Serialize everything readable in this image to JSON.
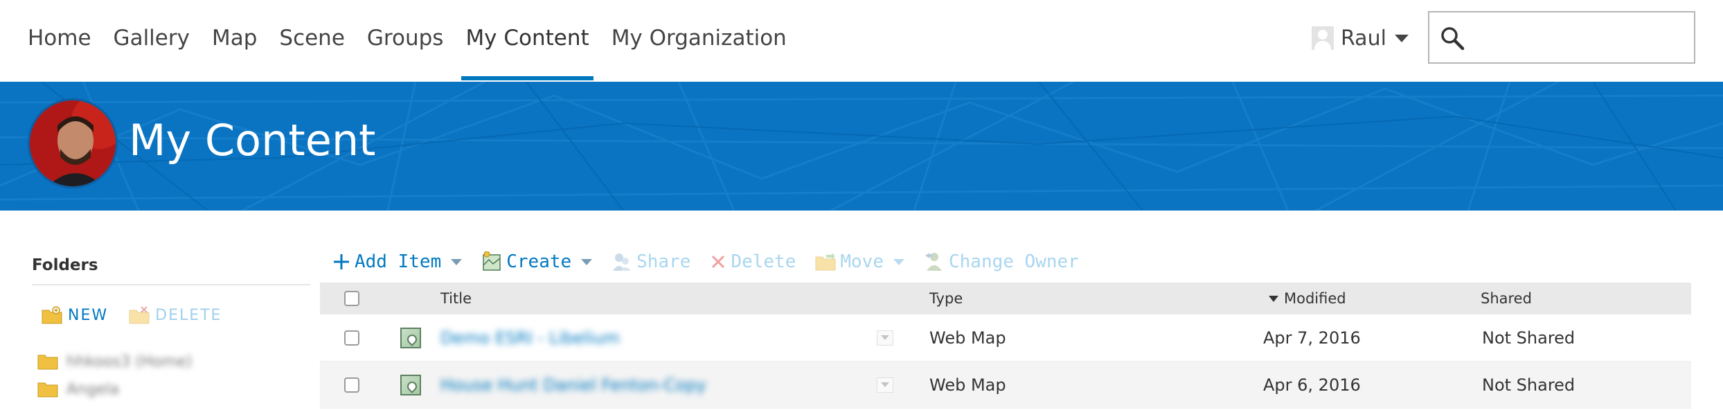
{
  "nav": {
    "links": [
      "Home",
      "Gallery",
      "Map",
      "Scene",
      "Groups",
      "My Content",
      "My Organization"
    ],
    "active_index": 5
  },
  "user": {
    "name": "Raul"
  },
  "search": {
    "placeholder": "",
    "value": ""
  },
  "banner": {
    "title": "My Content",
    "background_color": "#0a74c2"
  },
  "folders": {
    "title": "Folders",
    "actions": {
      "new_label": "NEW",
      "delete_label": "DELETE"
    },
    "items": [
      "hhkoos3 (Home)",
      "Angela"
    ]
  },
  "toolbar": {
    "add_item": "Add Item",
    "create": "Create",
    "share": "Share",
    "delete": "Delete",
    "move": "Move",
    "change_owner": "Change Owner"
  },
  "table": {
    "headers": {
      "title": "Title",
      "type": "Type",
      "modified": "Modified",
      "shared": "Shared"
    },
    "sort": {
      "column": "modified",
      "direction": "descending"
    },
    "rows": [
      {
        "title": "Demo ESRI - Libelium",
        "type": "Web Map",
        "modified": "Apr 7, 2016",
        "shared": "Not Shared"
      },
      {
        "title": "House Hunt Daniel Fenton-Copy",
        "type": "Web Map",
        "modified": "Apr 6, 2016",
        "shared": "Not Shared"
      }
    ]
  },
  "colors": {
    "accent": "#0079c1",
    "accent_disabled": "#a8d6f0",
    "header_row": "#e9e9e9",
    "alt_row": "#f4f4f4"
  },
  "icons": {
    "add_item": "plus-icon",
    "create": "create-map-icon",
    "share": "share-icon",
    "delete": "x-icon",
    "move": "move-folder-icon",
    "change_owner": "change-owner-icon",
    "search": "search-icon",
    "folder": "folder-icon"
  }
}
